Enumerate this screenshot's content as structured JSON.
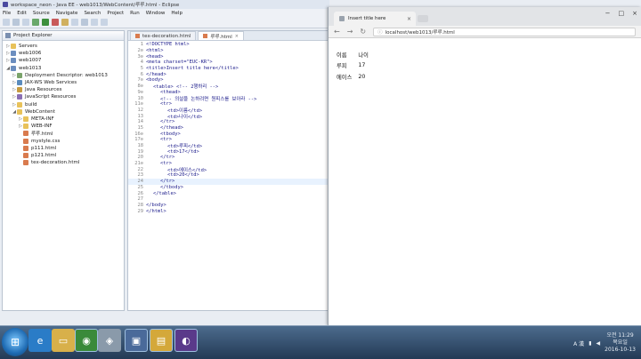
{
  "eclipse": {
    "title": "workspace_neon - Java EE - web1013/WebContent/루루.html - Eclipse",
    "menus": [
      "File",
      "Edit",
      "Source",
      "Navigate",
      "Search",
      "Project",
      "Run",
      "Window",
      "Help"
    ],
    "explorer_title": "Project Explorer",
    "tree": [
      {
        "label": "Servers",
        "indent": 0,
        "arrow": "▷",
        "icon": "folder-icon"
      },
      {
        "label": "web1006",
        "indent": 0,
        "arrow": "▷",
        "icon": "project-icon"
      },
      {
        "label": "web1007",
        "indent": 0,
        "arrow": "▷",
        "icon": "project-icon"
      },
      {
        "label": "web1013",
        "indent": 0,
        "arrow": "◢",
        "icon": "project-icon"
      },
      {
        "label": "Deployment Descriptor: web1013",
        "indent": 1,
        "arrow": "▷",
        "icon": "descriptor-icon"
      },
      {
        "label": "JAX-WS Web Services",
        "indent": 1,
        "arrow": "▷",
        "icon": "service-icon"
      },
      {
        "label": "Java Resources",
        "indent": 1,
        "arrow": "▷",
        "icon": "java-icon"
      },
      {
        "label": "JavaScript Resources",
        "indent": 1,
        "arrow": "▷",
        "icon": "js-icon"
      },
      {
        "label": "build",
        "indent": 1,
        "arrow": "▷",
        "icon": "folder-icon"
      },
      {
        "label": "WebContent",
        "indent": 1,
        "arrow": "◢",
        "icon": "folder-icon"
      },
      {
        "label": "META-INF",
        "indent": 2,
        "arrow": "▷",
        "icon": "folder-icon"
      },
      {
        "label": "WEB-INF",
        "indent": 2,
        "arrow": "▷",
        "icon": "folder-icon"
      },
      {
        "label": "루루.html",
        "indent": 2,
        "arrow": "",
        "icon": "file-icon"
      },
      {
        "label": "mystyle.css",
        "indent": 2,
        "arrow": "",
        "icon": "file-icon"
      },
      {
        "label": "p111.html",
        "indent": 2,
        "arrow": "",
        "icon": "file-icon"
      },
      {
        "label": "p121.html",
        "indent": 2,
        "arrow": "",
        "icon": "file-icon"
      },
      {
        "label": "tex-decoration.html",
        "indent": 2,
        "arrow": "",
        "icon": "file-icon"
      }
    ],
    "editor_tabs": [
      {
        "label": "tex-decoration.html",
        "active": false
      },
      {
        "label": "루루.html",
        "active": true
      }
    ],
    "code_lines": [
      {
        "n": "1",
        "text": "<!DOCTYPE html>",
        "indent": 0
      },
      {
        "n": "2⊖",
        "text": "<html>",
        "indent": 0
      },
      {
        "n": "3⊖",
        "text": "<head>",
        "indent": 0
      },
      {
        "n": "4",
        "text": "<meta charset=\"EUC-KR\">",
        "indent": 0
      },
      {
        "n": "5",
        "text": "<title>Insert title here</title>",
        "indent": 0
      },
      {
        "n": "6",
        "text": "</head>",
        "indent": 0
      },
      {
        "n": "7⊖",
        "text": "<body>",
        "indent": 0
      },
      {
        "n": "8⊖",
        "text": "<table> <!-- 2행하리 -->",
        "indent": 1
      },
      {
        "n": "9⊖",
        "text": "<thead>",
        "indent": 2
      },
      {
        "n": "10",
        "text": "<!-- 의설을 논하려면 원피스를 보아라 -->",
        "indent": 2
      },
      {
        "n": "11⊖",
        "text": "<tr>",
        "indent": 2
      },
      {
        "n": "12",
        "text": "<td>이름</td>",
        "indent": 3
      },
      {
        "n": "13",
        "text": "<td>나이</td>",
        "indent": 3
      },
      {
        "n": "14",
        "text": "</tr>",
        "indent": 2
      },
      {
        "n": "15",
        "text": "</thead>",
        "indent": 2
      },
      {
        "n": "16⊖",
        "text": "<tbody>",
        "indent": 2
      },
      {
        "n": "17⊖",
        "text": "<tr>",
        "indent": 2
      },
      {
        "n": "18",
        "text": "<td>루피</td>",
        "indent": 3
      },
      {
        "n": "19",
        "text": "<td>17</td>",
        "indent": 3
      },
      {
        "n": "20",
        "text": "</tr>",
        "indent": 2
      },
      {
        "n": "21⊖",
        "text": "<tr>",
        "indent": 2
      },
      {
        "n": "22",
        "text": "<td>에이스</td>",
        "indent": 3
      },
      {
        "n": "23",
        "text": "<td>20</td>",
        "indent": 3
      },
      {
        "n": "24",
        "text": "</tr>",
        "indent": 2
      },
      {
        "n": "25",
        "text": "</tbody>",
        "indent": 2
      },
      {
        "n": "26",
        "text": "</table>",
        "indent": 1
      },
      {
        "n": "27",
        "text": "",
        "indent": 0
      },
      {
        "n": "28",
        "text": "</body>",
        "indent": 0
      },
      {
        "n": "29",
        "text": "</html>",
        "indent": 0
      }
    ],
    "highlight_line": "24"
  },
  "browser": {
    "tab_title": "Insert title here",
    "url": "localhost/web1013/루루.html",
    "table": [
      [
        "이름",
        "나이"
      ],
      [
        "루피",
        "17"
      ],
      [
        "에이스",
        "20"
      ]
    ]
  },
  "taskbar": {
    "time": "오전 11:29",
    "weekday": "목요일",
    "date": "2016-10-13",
    "ime": "A 漢"
  },
  "colors": {
    "folder": "#e8c25a",
    "project": "#6c8ebf",
    "file": "#d97b4e",
    "java": "#c69b3f",
    "js": "#8a6fb3",
    "descriptor": "#7aa36a",
    "service": "#5a8bbd"
  }
}
